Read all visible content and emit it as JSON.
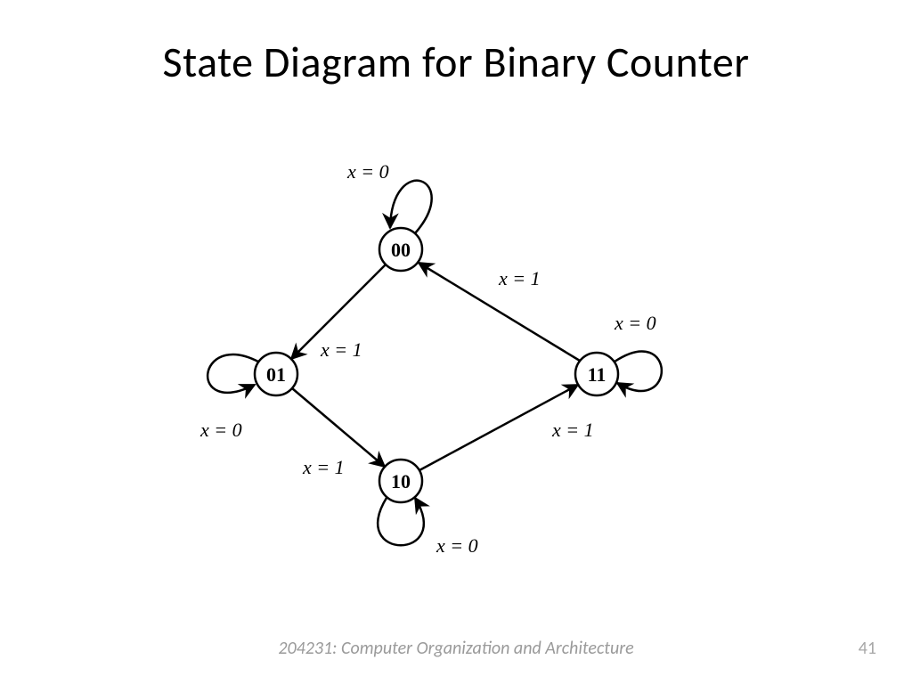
{
  "title": "State Diagram for Binary Counter",
  "footer": {
    "course": "204231: Computer Organization and Architecture",
    "page": "41"
  },
  "states": {
    "s00": "00",
    "s01": "01",
    "s10": "10",
    "s11": "11"
  },
  "edges": {
    "self00": "x = 0",
    "self01": "x = 0",
    "self10": "x = 0",
    "self11": "x = 0",
    "e00_01": "x = 1",
    "e01_10": "x = 1",
    "e10_11": "x = 1",
    "e11_00": "x = 1"
  }
}
